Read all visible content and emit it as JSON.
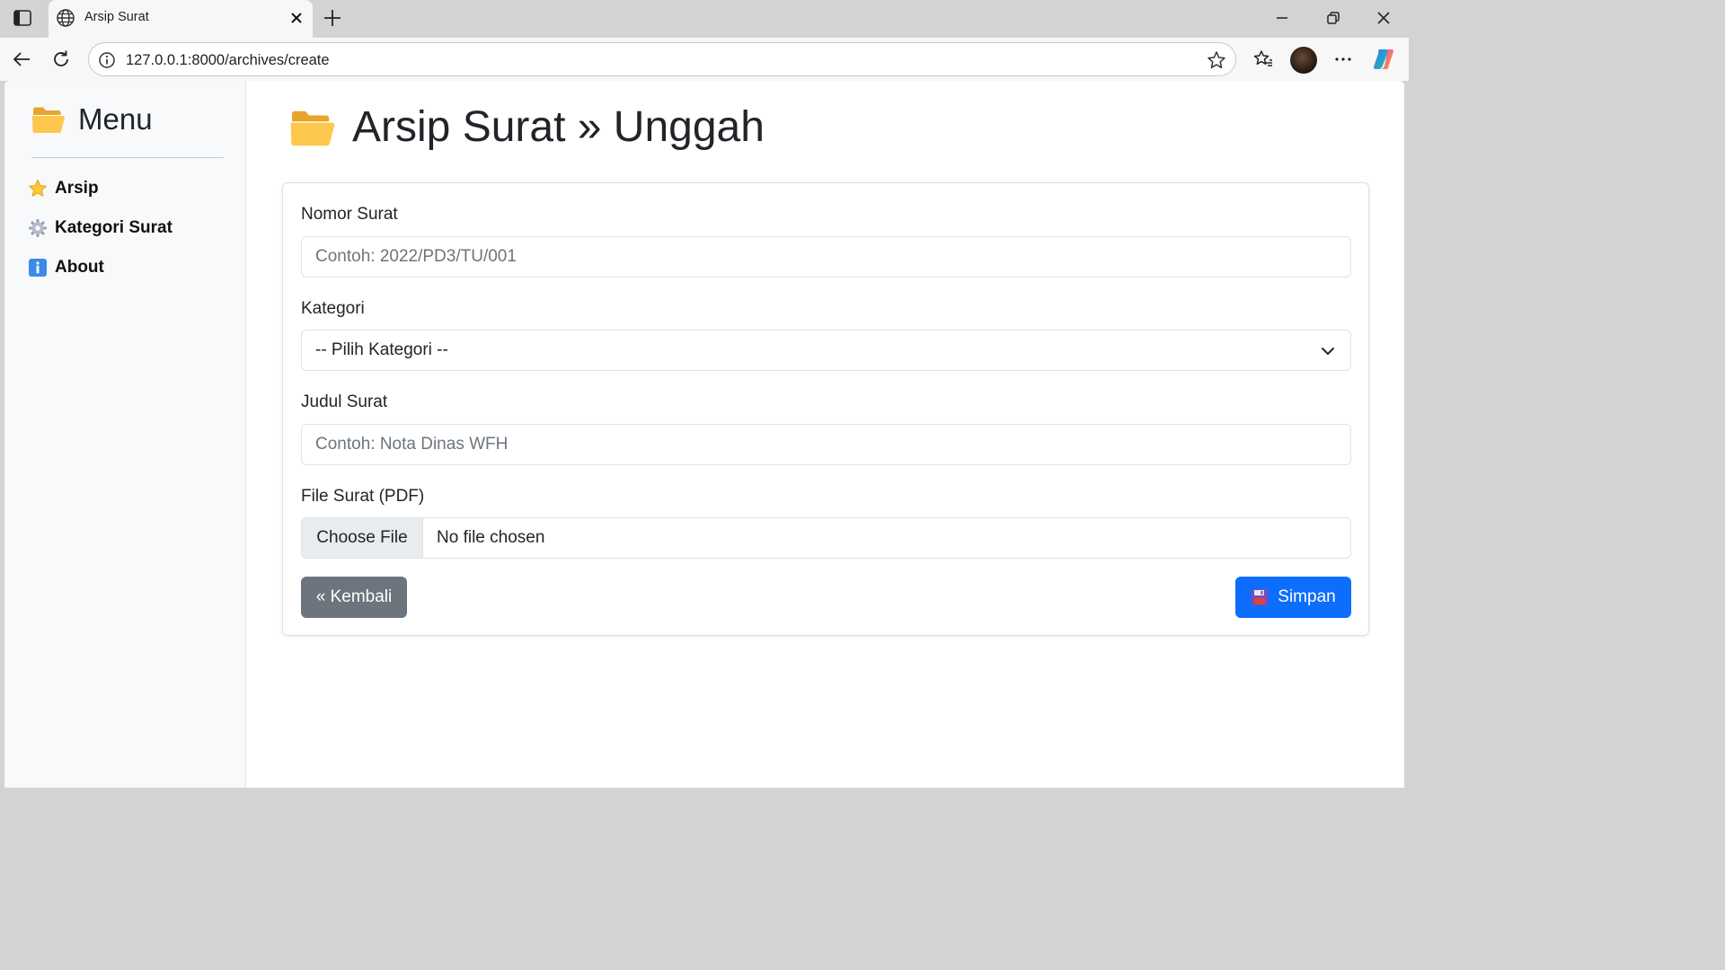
{
  "browser": {
    "tab_title": "Arsip Surat",
    "url": "127.0.0.1:8000/archives/create"
  },
  "sidebar": {
    "title": "Menu",
    "items": [
      {
        "label": "Arsip",
        "icon": "star-icon"
      },
      {
        "label": "Kategori Surat",
        "icon": "gear-icon"
      },
      {
        "label": "About",
        "icon": "info-icon"
      }
    ]
  },
  "page": {
    "title": "Arsip Surat » Unggah",
    "icon": "open-folder-icon"
  },
  "form": {
    "nomor_label": "Nomor Surat",
    "nomor_placeholder": "Contoh: 2022/PD3/TU/001",
    "kategori_label": "Kategori",
    "kategori_selected": "-- Pilih Kategori --",
    "judul_label": "Judul Surat",
    "judul_placeholder": "Contoh: Nota Dinas WFH",
    "file_label": "File Surat (PDF)",
    "choose_file": "Choose File",
    "no_file": "No file chosen",
    "back_label": "« Kembali",
    "save_label": "Simpan"
  },
  "colors": {
    "primary": "#0d6efd",
    "secondary": "#6c757d",
    "sidebar_bg": "#f8f9fa",
    "folder": "#f5b731"
  }
}
